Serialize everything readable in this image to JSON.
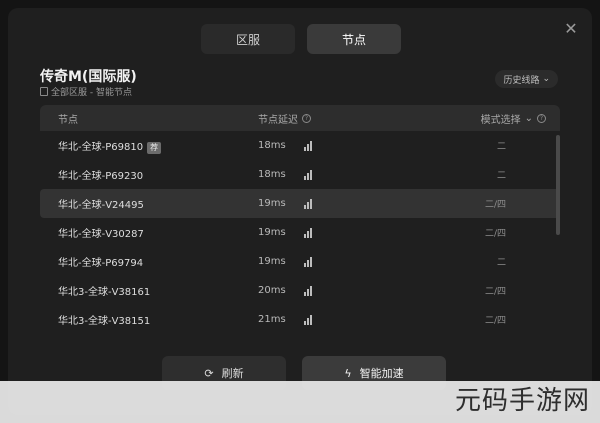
{
  "tabs": [
    {
      "label": "区服"
    },
    {
      "label": "节点"
    }
  ],
  "game": {
    "title": "传奇M(国际服)",
    "breadcrumb": "全部区服 - 智能节点"
  },
  "history_label": "历史线路",
  "table": {
    "headers": {
      "node": "节点",
      "latency": "节点延迟",
      "mode": "模式选择"
    },
    "rows": [
      {
        "node": "华北-全球-P69810",
        "badge": "荐",
        "latency": "18ms",
        "mode": "二"
      },
      {
        "node": "华北-全球-P69230",
        "badge": "",
        "latency": "18ms",
        "mode": "二"
      },
      {
        "node": "华北-全球-V24495",
        "badge": "",
        "latency": "19ms",
        "mode": "二/四"
      },
      {
        "node": "华北-全球-V30287",
        "badge": "",
        "latency": "19ms",
        "mode": "二/四"
      },
      {
        "node": "华北-全球-P69794",
        "badge": "",
        "latency": "19ms",
        "mode": "二"
      },
      {
        "node": "华北3-全球-V38161",
        "badge": "",
        "latency": "20ms",
        "mode": "二/四"
      },
      {
        "node": "华北3-全球-V38151",
        "badge": "",
        "latency": "21ms",
        "mode": "二/四"
      }
    ]
  },
  "buttons": {
    "refresh": "刷新",
    "boost": "智能加速"
  },
  "watermark": "元码手游网",
  "icons": {
    "close": "close-icon",
    "refresh": "refresh-icon",
    "boost": "lightning-icon",
    "signal": "signal-bars-icon"
  }
}
